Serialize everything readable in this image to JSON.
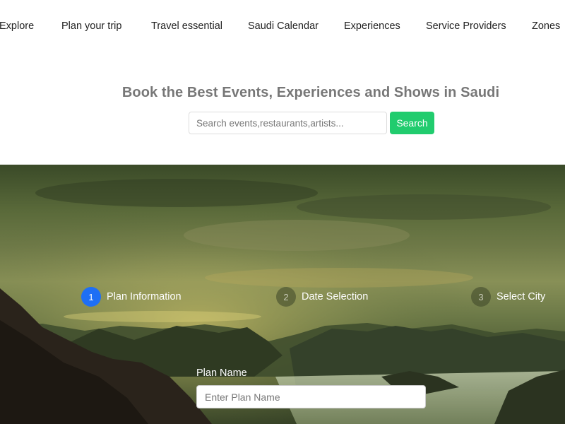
{
  "nav": {
    "items": [
      "Explore",
      "Plan your trip",
      "Travel essential",
      "Saudi Calendar",
      "Experiences",
      "Service Providers",
      "Zones"
    ]
  },
  "hero": {
    "title": "Book the Best Events, Experiences and Shows in Saudi",
    "search_placeholder": "Search events,restaurants,artists...",
    "search_button": "Search"
  },
  "steps": [
    {
      "number": "1",
      "label": "Plan Information",
      "active": true
    },
    {
      "number": "2",
      "label": "Date Selection",
      "active": false
    },
    {
      "number": "3",
      "label": "Select City",
      "active": false
    }
  ],
  "form": {
    "plan_name_label": "Plan Name",
    "plan_name_placeholder": "Enter Plan Name"
  },
  "colors": {
    "accent": "#1e6ff5",
    "search_button": "#21cc6e"
  }
}
